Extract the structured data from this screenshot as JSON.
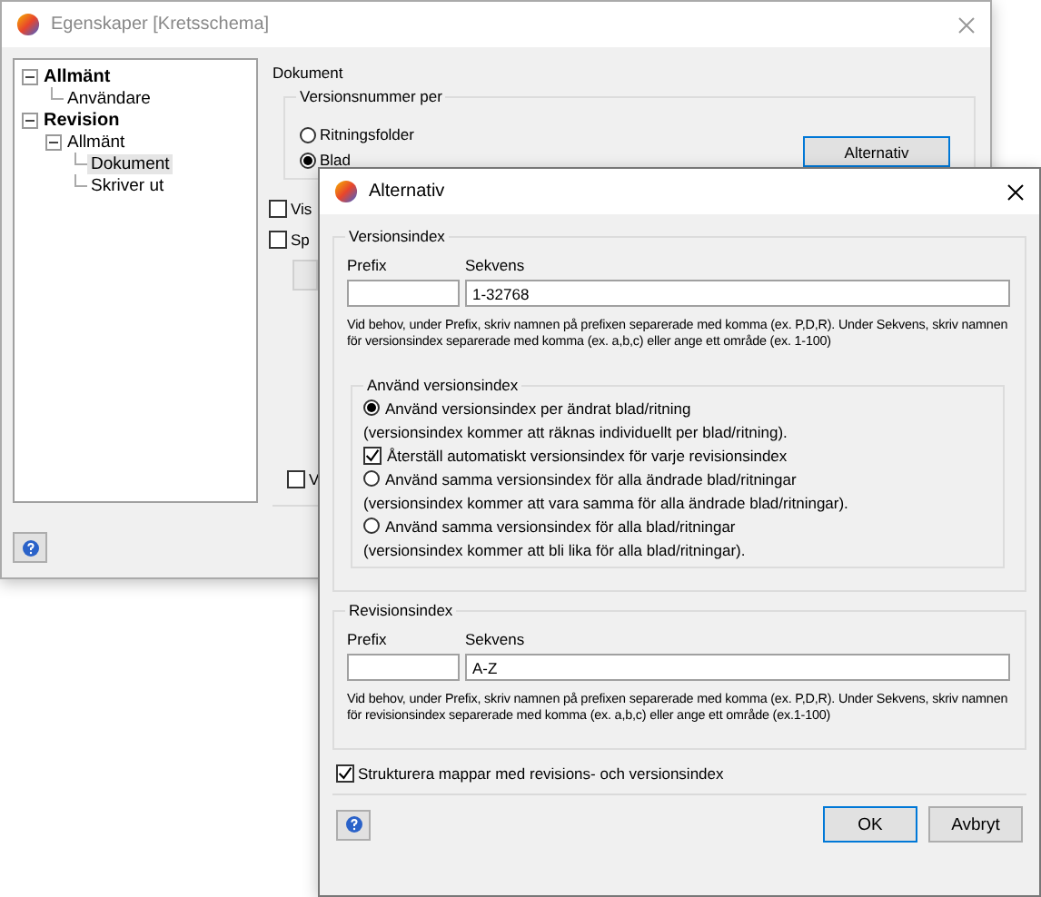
{
  "main_window": {
    "title": "Egenskaper [Kretsschema]",
    "tree": [
      {
        "label": "Allmänt",
        "expanded": true,
        "selected": false,
        "children": [
          {
            "label": "Användare",
            "selected": false
          }
        ]
      },
      {
        "label": "Revision",
        "expanded": true,
        "selected": false,
        "children": [
          {
            "label": "Allmänt",
            "expanded": true,
            "selected": false,
            "children": [
              {
                "label": "Dokument",
                "selected": true
              },
              {
                "label": "Skriver ut",
                "selected": false
              }
            ]
          }
        ]
      }
    ],
    "section_title": "Dokument",
    "version_group": {
      "title": "Versionsnummer per",
      "options": [
        {
          "label": "Ritningsfolder",
          "selected": false
        },
        {
          "label": "Blad",
          "selected": true
        }
      ],
      "button": "Alternativ"
    },
    "checkboxes": [
      {
        "label": "Vis",
        "checked": false
      },
      {
        "label": "Sp",
        "checked": false
      }
    ],
    "bottom_checkbox": {
      "label": "V",
      "checked": false
    }
  },
  "dialog": {
    "title": "Alternativ",
    "version_index": {
      "title": "Versionsindex",
      "prefix_label": "Prefix",
      "sequence_label": "Sekvens",
      "sequence_value": "1-32768",
      "help": "Vid behov, under Prefix, skriv namnen på prefixen separerade med komma (ex. P,D,R). Under Sekvens, skriv namnen för versionsindex separerade med komma (ex. a,b,c) eller ange ett område (ex. 1-100)",
      "use_group": {
        "title": "Använd versionsindex",
        "items": [
          {
            "kind": "radio",
            "label": "Använd versionsindex per ändrat blad/ritning",
            "selected": true
          },
          {
            "kind": "note",
            "label": "(versionsindex kommer att räknas individuellt per blad/ritning)."
          },
          {
            "kind": "checkbox",
            "label": "Återställ automatiskt versionsindex för varje revisionsindex",
            "checked": true
          },
          {
            "kind": "radio",
            "label": "Använd samma versionsindex för alla ändrade blad/ritningar",
            "selected": false
          },
          {
            "kind": "note",
            "label": "(versionsindex kommer att vara samma för alla ändrade blad/ritningar)."
          },
          {
            "kind": "radio",
            "label": "Använd samma versionsindex för alla blad/ritningar",
            "selected": false
          },
          {
            "kind": "note",
            "label": "(versionsindex kommer att bli lika för alla blad/ritningar)."
          }
        ]
      }
    },
    "revision_index": {
      "title": "Revisionsindex",
      "prefix_label": "Prefix",
      "sequence_label": "Sekvens",
      "sequence_value": "A-Z",
      "help": "Vid behov, under Prefix, skriv namnen på prefixen separerade med komma (ex. P,D,R). Under Sekvens, skriv namnen för revisionsindex separerade med komma (ex. a,b,c) eller ange ett område (ex.1-100)"
    },
    "structure_checkbox": {
      "label": "Strukturera mappar med revisions- och versionsindex",
      "checked": true
    },
    "buttons": [
      {
        "label": "OK",
        "default": true
      },
      {
        "label": "Avbryt",
        "default": false
      }
    ]
  }
}
